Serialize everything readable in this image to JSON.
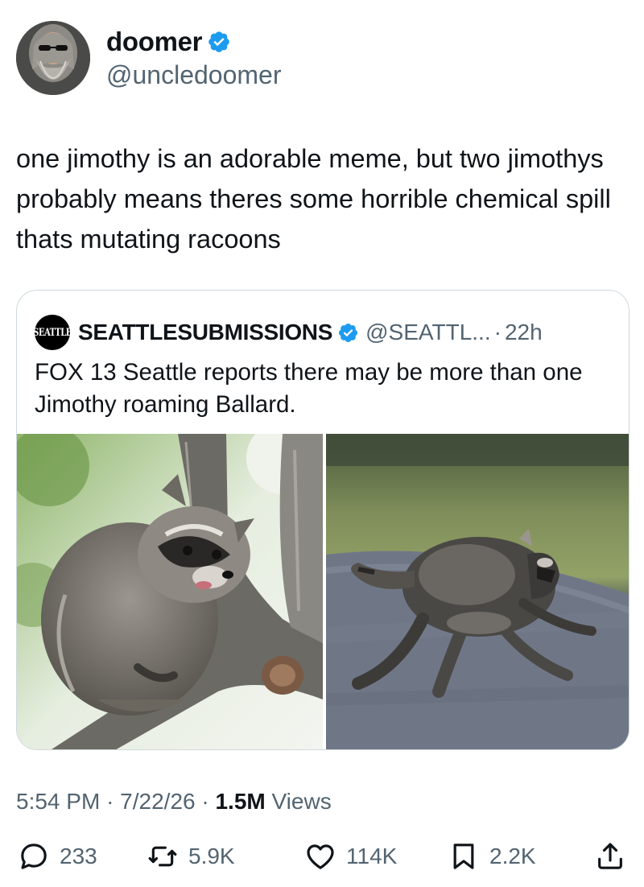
{
  "author": {
    "display_name": "doomer",
    "handle": "@uncledoomer",
    "verified": true,
    "avatar_icon": "avatar-bearded-man"
  },
  "tweet": {
    "text": "one jimothy is an adorable meme, but two jimothys probably means theres some horrible chemical spill thats mutating racoons"
  },
  "quoted": {
    "logo_text": "SEATTLE",
    "display_name": "SEATTLESUBMISSIONS",
    "verified": true,
    "handle": "@SEATTL...",
    "separator": "·",
    "time": "22h",
    "text": "FOX 13 Seattle reports there may be more than one Jimothy roaming Ballard.",
    "images": [
      "raccoon-in-tree-photo",
      "raccoon-running-photo"
    ]
  },
  "meta": {
    "time": "5:54 PM",
    "sep1": "·",
    "date": "7/22/26",
    "sep2": "·",
    "views_count": "1.5M",
    "views_label": "Views"
  },
  "actions": {
    "replies": "233",
    "reposts": "5.9K",
    "likes": "114K",
    "bookmarks": "2.2K"
  },
  "colors": {
    "accent": "#1d9bf0",
    "text": "#0f1419",
    "secondary": "#536471",
    "border": "#cfd9de"
  }
}
